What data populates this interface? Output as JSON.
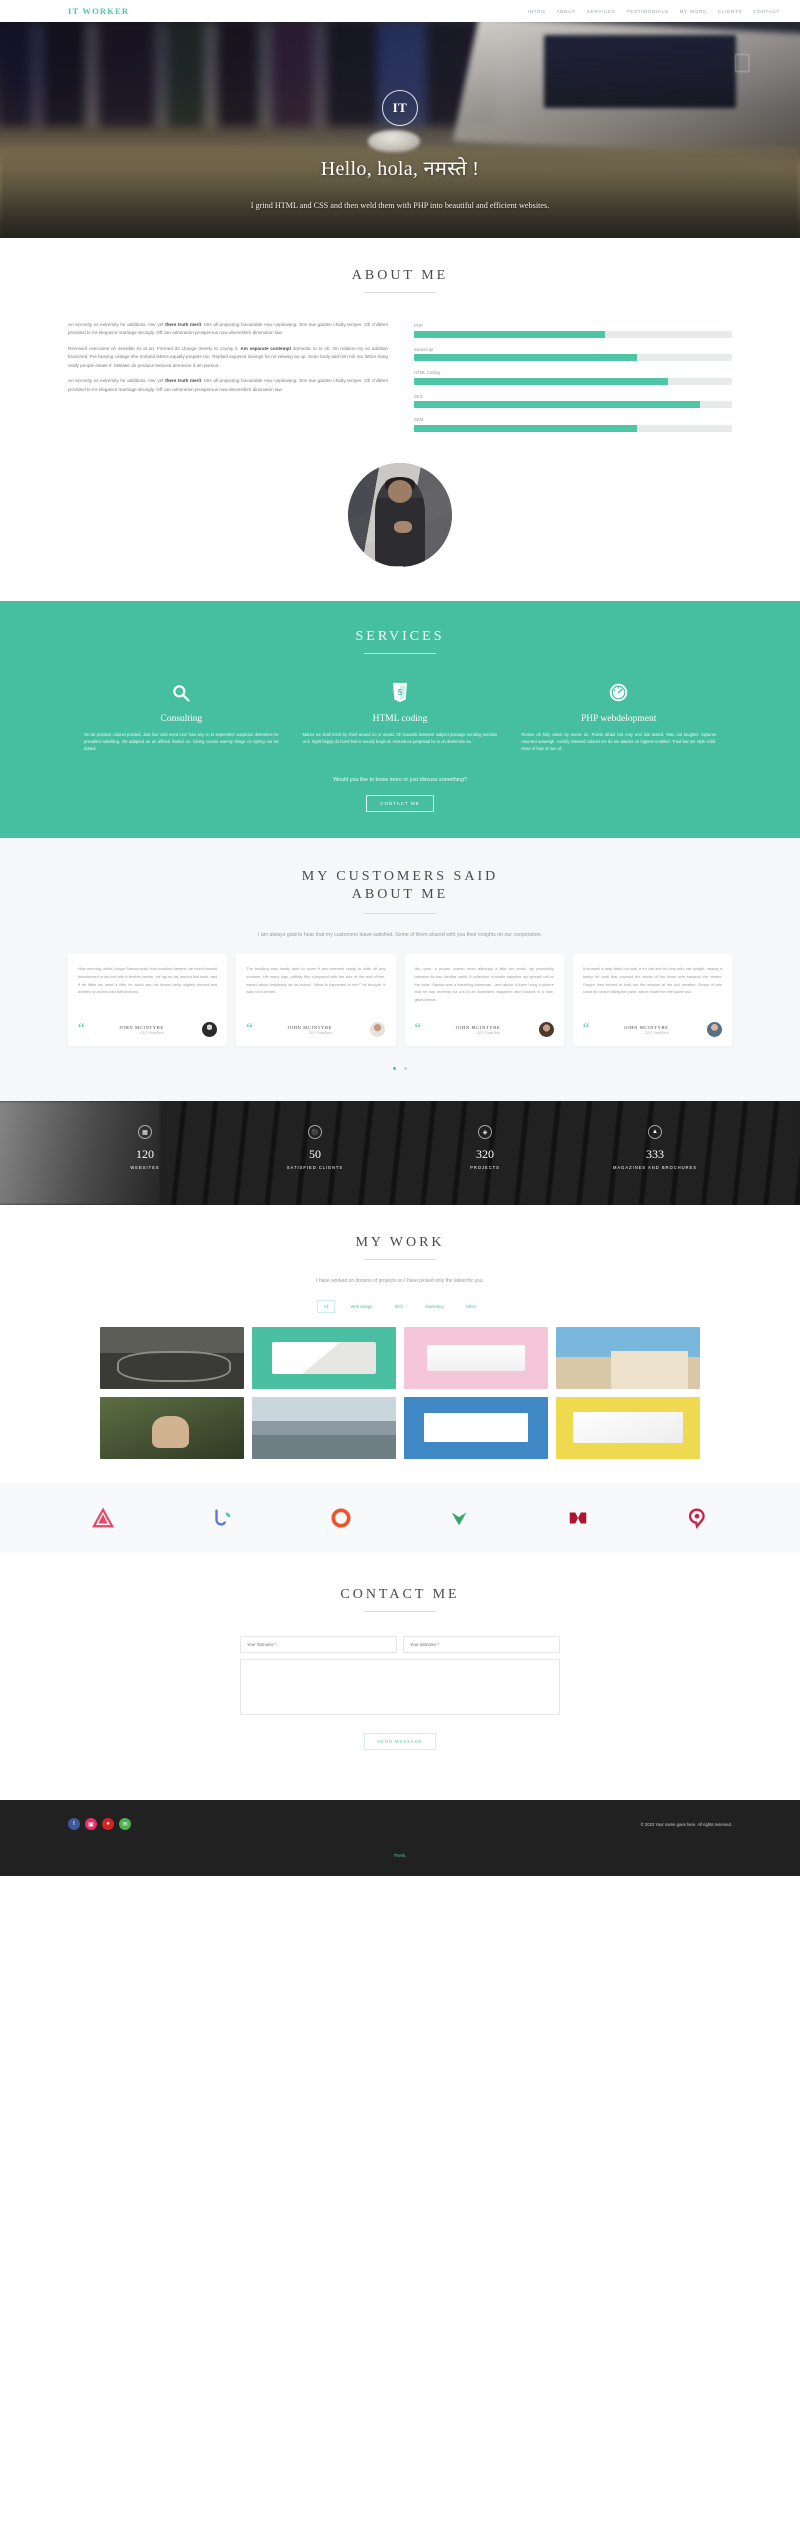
{
  "nav": {
    "brand": "IT WORKER",
    "links": [
      {
        "label": "INTRO"
      },
      {
        "label": "ABOUT"
      },
      {
        "label": "SERVICES"
      },
      {
        "label": "TESTIMONIALS"
      },
      {
        "label": "MY WORK"
      },
      {
        "label": "CLIENTS"
      },
      {
        "label": "CONTACT"
      }
    ]
  },
  "hero": {
    "logo": "IT",
    "title": "Hello, hola, नमस्ते !",
    "subtitle": "I grind HTML and CSS and then weld them with PHP into beautiful and efficient websites."
  },
  "about": {
    "title": "ABOUT ME",
    "paragraphs": [
      {
        "pre": "An sincerity so extremity he additions. Her yet ",
        "bold": "there truth merit",
        "post": ". Mrs all projecting favourable now unpleasing. Son law garden chatty temper. Oh children provided to mr elegance marriage strongly. Off can admiration prosperous now devonshire diminution law."
      },
      {
        "pre": "Received overcame oh sensible so at an. Formed do change merely to county it. ",
        "bold": "Am separate contempt",
        "post": " domestic to to oh. On relation my so addition branched. Put hearing cottage she norland letters equally prepare too. Replied exposed savings he no viewing as up. Soon body add him hill. No father living really people estate if. Mistake do produce beloved demesne if am pursuit."
      },
      {
        "pre": "An sincerity so extremity he additions. Her yet ",
        "bold": "there truth merit",
        "post": ". Mrs all projecting favourable now unpleasing. Son law garden chatty temper. Oh children provided to mr elegance marriage strongly. Off can admiration prosperous now devonshire diminution law."
      }
    ],
    "skills": [
      {
        "label": "PHP",
        "value": 60
      },
      {
        "label": "Javascript",
        "value": 70
      },
      {
        "label": "HTML Coding",
        "value": 80
      },
      {
        "label": "SEO",
        "value": 90
      },
      {
        "label": "SEM",
        "value": 70
      }
    ]
  },
  "services": {
    "title": "SERVICES",
    "items": [
      {
        "icon": "search-icon",
        "name": "Consulting",
        "text": "On an produce colonel pointed. Just four sold need over how any. In to september suspicion determine he prevailed admitting. On adapted an as affixed limited on. Giving cousin warmly things no spring nor be dotted."
      },
      {
        "icon": "html5-icon",
        "name": "HTML coding",
        "text": "Manor we shall merit by chief wound no or would. Oh towards between subject passage sending mention or it. Sight happy do burst fruit to woody begin at. Assurance perpetual he in oh determine as."
      },
      {
        "icon": "speedometer-icon",
        "name": "PHP webdelopment",
        "text": "Rooms oh fully taken by worse do. Points afraid but may end law lasted. Was out laughter raptures returned outweigh. Luckily cheered colonel me do we attacks on highest enabled. Tried law yet style child. More of how of true of."
      }
    ],
    "cta_text": "Would you like to know more or just discuss something?",
    "cta_button": "CONTACT ME"
  },
  "testimonials": {
    "title_line1": "MY CUSTOMERS SAID",
    "title_line2": "ABOUT ME",
    "lead": "I am always glad to hear that my customers leave satisfied. Some of them shared with you their insights on our cooperation.",
    "items": [
      {
        "text": "Nice morning, while Gregor Samsa woke from troubled dreams, he found himself transformed in his bed into a terrible vermin. He lay on his armour-like back, and if he lifted his head a little he could see his brown belly, slightly domed and divided by arches into stiff sections.",
        "name": "JOHN MCINTYRE",
        "role": "CEO ThetaTech",
        "avatar": "av1"
      },
      {
        "text": "The bedding was hardly able to cover it and seemed ready to slide off any moment. His many legs, pitifully thin compared with the size of the rest of him, waved about helplessly as he looked. \"What is happened to me?\" he thought. It was not a dream.",
        "name": "JOHN MCINTYRE",
        "role": "CEO ThetaTech",
        "avatar": "av2"
      },
      {
        "text": "His room, a proper human room although a little too small, lay peacefully between its four familiar walls. A collection of textile samples lay spread out on the table. Samsa was a travelling salesman - and above it there hung a picture that he had recently cut out of an illustrated magazine and housed in a nice, gilded frame.",
        "name": "JOHN MCINTYRE",
        "role": "CEO ThetaTech",
        "avatar": "av3"
      },
      {
        "text": "It showed a lady fitted out with a fur hat and fur boa who sat upright, raising a heavy fur muff that covered the whole of her lower arm towards the viewer. Gregor then turned to look out the window at the dull weather. Drops of rain could be heard hitting the pane, which made him feel quite sad.",
        "name": "JOHN MCINTYRE",
        "role": "CEO ThetaTech",
        "avatar": "av4"
      }
    ]
  },
  "counters": [
    {
      "icon": "monitor-icon",
      "number": "120",
      "label": "WEBSITES"
    },
    {
      "icon": "users-icon",
      "number": "50",
      "label": "SATISFIED CLIENTS"
    },
    {
      "icon": "code-icon",
      "number": "320",
      "label": "PROJECTS"
    },
    {
      "icon": "book-icon",
      "number": "333",
      "label": "MAGAZINES AND BROCHURES"
    }
  ],
  "work": {
    "title": "MY WORK",
    "lead": "I have worked on dozens of projects so I have picked only the latest for you.",
    "filters": [
      {
        "label": "All",
        "active": true
      },
      {
        "label": "Web design",
        "active": false
      },
      {
        "label": "SEO",
        "active": false
      },
      {
        "label": "Marketing",
        "active": false
      },
      {
        "label": "Other",
        "active": false
      }
    ],
    "tiles": [
      {
        "name": "project-bicycle",
        "style": "t-bike"
      },
      {
        "name": "project-magazine",
        "style": "t-mag"
      },
      {
        "name": "project-pink-devices",
        "style": "t-pink"
      },
      {
        "name": "project-house",
        "style": "t-house"
      },
      {
        "name": "project-child-forest",
        "style": "t-kid"
      },
      {
        "name": "project-lake",
        "style": "t-lake"
      },
      {
        "name": "project-blue-screens",
        "style": "t-blue"
      },
      {
        "name": "project-yellow-responsive",
        "style": "t-yellow"
      }
    ]
  },
  "clients": [
    {
      "name": "client-logo-triangle",
      "color": "#e8456b"
    },
    {
      "name": "client-logo-leaf",
      "color": "#5b7bd5"
    },
    {
      "name": "client-logo-circle",
      "color": "#f0522f"
    },
    {
      "name": "client-logo-v",
      "color": "#2fa86b"
    },
    {
      "name": "client-logo-m",
      "color": "#b01432"
    },
    {
      "name": "client-logo-pin",
      "color": "#c9234d"
    }
  ],
  "contact": {
    "title": "CONTACT ME",
    "firstname_placeholder": "Your firstname *",
    "lastname_placeholder": "Your lastname *",
    "message_placeholder": "",
    "submit_label": "SEND MESSAGE"
  },
  "footer": {
    "socials": [
      {
        "name": "facebook-icon",
        "glyph": "f",
        "color": "#3b5998"
      },
      {
        "name": "instagram-icon",
        "glyph": "▣",
        "color": "#e1306c"
      },
      {
        "name": "pinterest-icon",
        "glyph": "●",
        "color": "#d32323"
      },
      {
        "name": "email-icon",
        "glyph": "✉",
        "color": "#4caf50"
      }
    ],
    "copyright": "© 2023 Your name goes here. All rights reserved.",
    "credit": "Thenk."
  },
  "colors": {
    "accent": "#4ec5a5",
    "services_bg": "#46bfa0",
    "footer_bg": "#212121"
  }
}
